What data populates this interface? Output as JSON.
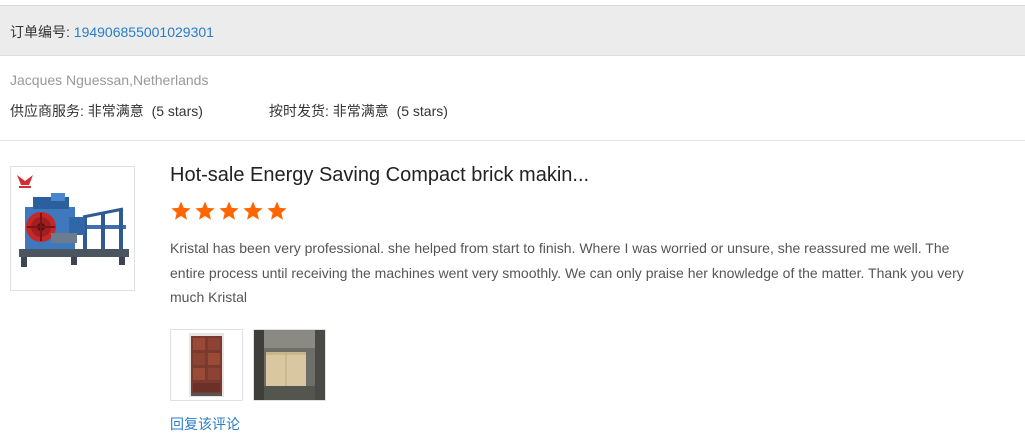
{
  "order": {
    "label": "订单编号: ",
    "number": "194906855001029301"
  },
  "buyer": {
    "name": "Jacques Nguessan,Netherlands"
  },
  "ratings": [
    {
      "label": "供应商服务: ",
      "value": "非常满意",
      "stars_text": "(5 stars)"
    },
    {
      "label": "按时发货: ",
      "value": "非常满意",
      "stars_text": "(5 stars)"
    }
  ],
  "product": {
    "title": "Hot-sale Energy Saving Compact brick makin...",
    "rating": 5,
    "star_color": "#ff6600",
    "image_icon": "brick-machine-image"
  },
  "review": {
    "text": "Kristal has been very professional. she helped from start to finish. Where I was worried or unsure, she reassured me well. The entire process until receiving the machines went very smoothly. We can only praise her knowledge of the matter. Thank you very much Kristal"
  },
  "attachments": [
    {
      "icon": "photo-thumbnail"
    },
    {
      "icon": "photo-thumbnail"
    }
  ],
  "actions": {
    "reply_label": "回复该评论"
  },
  "colors": {
    "link": "#2a7cc7",
    "order_bar_bg": "#ececec"
  }
}
